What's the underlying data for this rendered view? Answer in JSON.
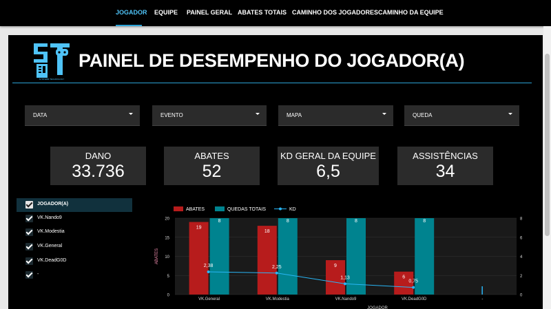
{
  "nav": {
    "tabs": [
      {
        "label": "JOGADOR",
        "active": true
      },
      {
        "label": "EQUIPE",
        "active": false
      },
      {
        "label": "PAINEL GERAL",
        "active": false
      },
      {
        "label": "ABATES TOTAIS",
        "active": false
      },
      {
        "label": "CAMINHO DOS JOGADORES",
        "active": false
      },
      {
        "label": "CAMINHO DA EQUIPE",
        "active": false
      }
    ]
  },
  "header": {
    "title": "PAINEL DE DESEMPENHO DO JOGADOR(A)",
    "logo_text": "SYNTERM TECHNOLOGY"
  },
  "filters": [
    {
      "label": "DATA"
    },
    {
      "label": "EVENTO"
    },
    {
      "label": "MAPA"
    },
    {
      "label": "QUEDA"
    }
  ],
  "kpis": [
    {
      "label": "DANO",
      "value": "33.736"
    },
    {
      "label": "ABATES",
      "value": "52"
    },
    {
      "label": "KD GERAL DA EQUIPE",
      "value": "6,5"
    },
    {
      "label": "ASSISTÊNCIAS",
      "value": "34"
    }
  ],
  "players": {
    "header": "JOGADOR(A)",
    "items": [
      "VK.Nando9",
      "VK.Modestia",
      "VK.General",
      "VK.DeadG0D",
      "-"
    ]
  },
  "colors": {
    "accent": "#2ba4d8",
    "abates": "#b71c1c",
    "quedas": "#00838f",
    "kd": "#29b6f6"
  },
  "chart_data": {
    "type": "bar",
    "categories": [
      "VK.General",
      "VK.Modestia",
      "VK.Nando9",
      "VK.DeadG0D",
      "-"
    ],
    "series": [
      {
        "name": "ABATES",
        "type": "bar",
        "axis": "left",
        "values": [
          19,
          18,
          9,
          6,
          null
        ]
      },
      {
        "name": "QUEDAS TOTAIS",
        "type": "bar",
        "axis": "right",
        "values": [
          8,
          8,
          8,
          8,
          null
        ]
      },
      {
        "name": "KD",
        "type": "line",
        "axis": "right",
        "values": [
          2.38,
          2.25,
          1.13,
          0.75,
          null
        ]
      }
    ],
    "bar_labels": {
      "ABATES": [
        "19",
        "18",
        "9",
        "6",
        ""
      ],
      "QUEDAS TOTAIS": [
        "8",
        "8",
        "8",
        "8",
        ""
      ],
      "KD": [
        "2,38",
        "2,25",
        "1,13",
        "0,75",
        ""
      ]
    },
    "xlabel": "JOGADOR",
    "ylabel": "ABATES",
    "ylim": [
      0,
      20
    ],
    "yticks": [
      0,
      5,
      10,
      15,
      20
    ],
    "y2lim": [
      0,
      8
    ],
    "y2ticks": [
      0,
      2,
      4,
      6,
      8
    ],
    "legend": "top-left"
  }
}
